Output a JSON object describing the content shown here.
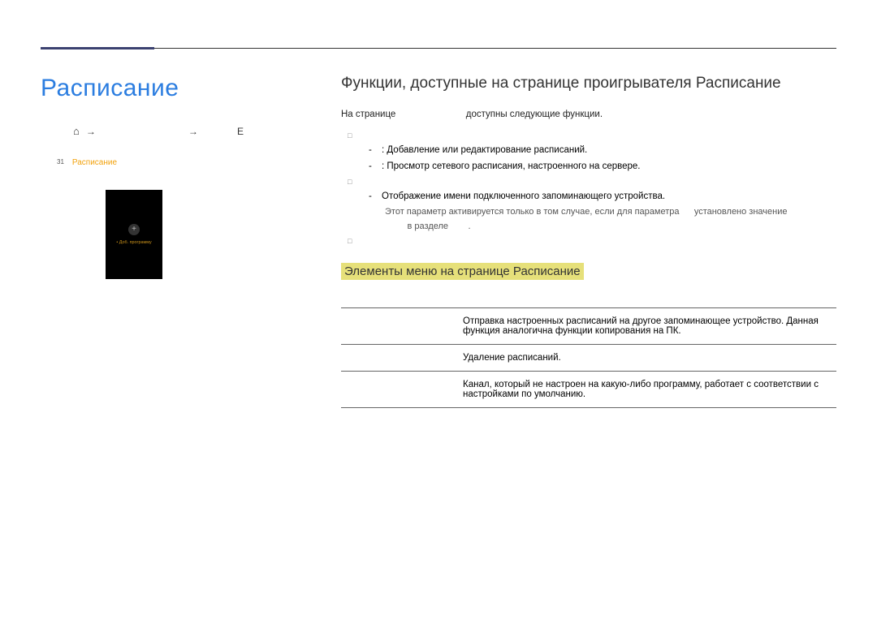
{
  "nav": {
    "title": "Расписание",
    "home_icon": "⌂",
    "arrow": "→",
    "step1": "",
    "step2": "",
    "key": "E"
  },
  "tile": {
    "num": "31",
    "label": "Расписание",
    "plus": "+",
    "caption": "• Доб. программу"
  },
  "main": {
    "h2": "Функции, доступные на странице проигрывателя Расписание",
    "intro_a": "На странице",
    "intro_b": "доступны следующие функции."
  },
  "list": {
    "l1a": ": Добавление или редактирование расписаний.",
    "l1b": ": Просмотр сетевого расписания, настроенного на сервере.",
    "l2a": "Отображение имени подключенного запоминающего устройства.",
    "note_a": "Этот параметр активируется только в том случае, если для параметра",
    "note_b": "установлено значение",
    "note_c": "в разделе",
    "note_d": "."
  },
  "subhead": "Элементы меню на странице Расписание",
  "table": {
    "col1": "",
    "col2": "",
    "rows": [
      {
        "name": "",
        "desc": "Отправка настроенных расписаний на другое запоминающее устройство. Данная функция аналогична функции копирования на ПК."
      },
      {
        "name": "",
        "desc": "Удаление расписаний."
      },
      {
        "name": "",
        "desc": "Канал, который не настроен на какую-либо программу, работает с соответствии с настройками по умолчанию."
      }
    ]
  }
}
